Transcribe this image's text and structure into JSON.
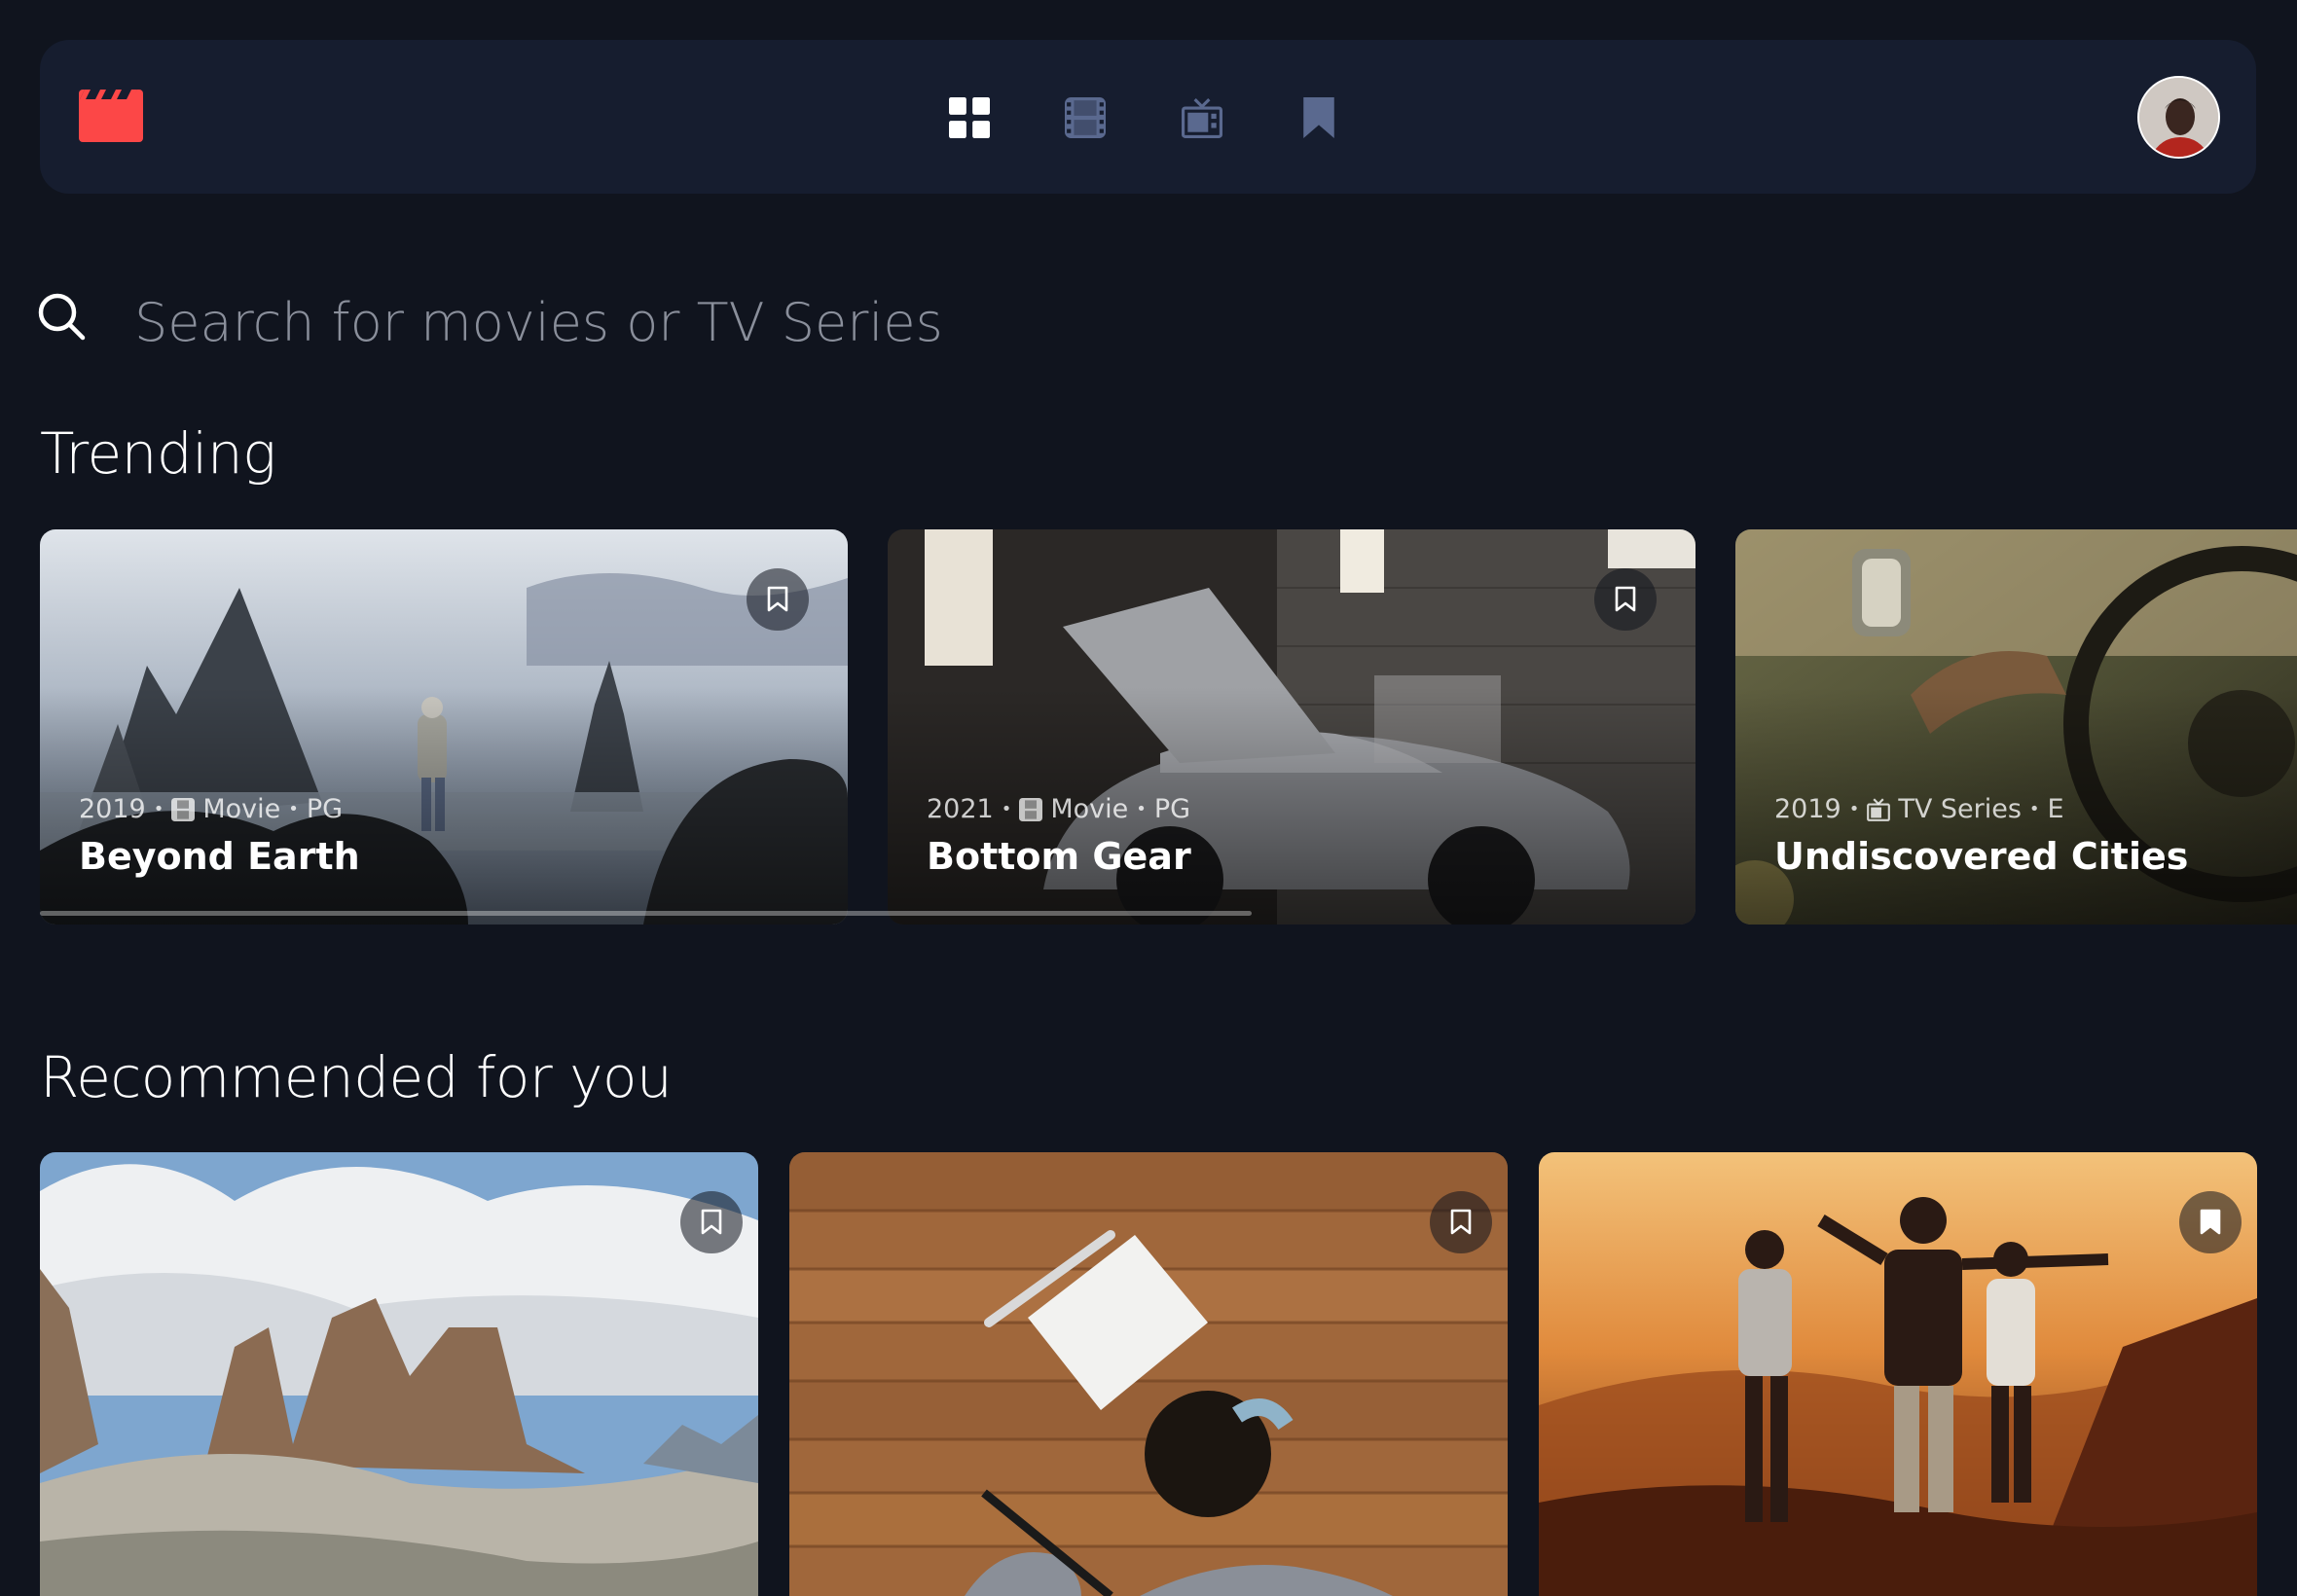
{
  "nav": {
    "logo": "clapperboard-logo",
    "items": [
      {
        "name": "home",
        "icon": "grid-icon",
        "active": true
      },
      {
        "name": "movies",
        "icon": "film-icon",
        "active": false
      },
      {
        "name": "tv-series",
        "icon": "tv-icon",
        "active": false
      },
      {
        "name": "bookmarked",
        "icon": "bookmark-icon",
        "active": false
      }
    ],
    "avatar": "user-avatar"
  },
  "search": {
    "placeholder": "Search for movies or TV Series",
    "value": ""
  },
  "sections": {
    "trending": "Trending",
    "recommended": "Recommended for you"
  },
  "trending": [
    {
      "year": "2019",
      "category": "Movie",
      "category_icon": "film-icon",
      "rating": "PG",
      "title": "Beyond Earth",
      "bookmarked": false
    },
    {
      "year": "2021",
      "category": "Movie",
      "category_icon": "film-icon",
      "rating": "PG",
      "title": "Bottom Gear",
      "bookmarked": false
    },
    {
      "year": "2019",
      "category": "TV Series",
      "category_icon": "tv-icon",
      "rating": "E",
      "title": "Undiscovered Cities",
      "bookmarked": false
    }
  ],
  "recommended": [
    {
      "bookmarked": false
    },
    {
      "bookmarked": false
    },
    {
      "bookmarked": true
    }
  ],
  "colors": {
    "background": "#10141E",
    "surface": "#161D2F",
    "accent": "#FC4747",
    "nav_inactive": "#5A698F",
    "white": "#FFFFFF"
  }
}
